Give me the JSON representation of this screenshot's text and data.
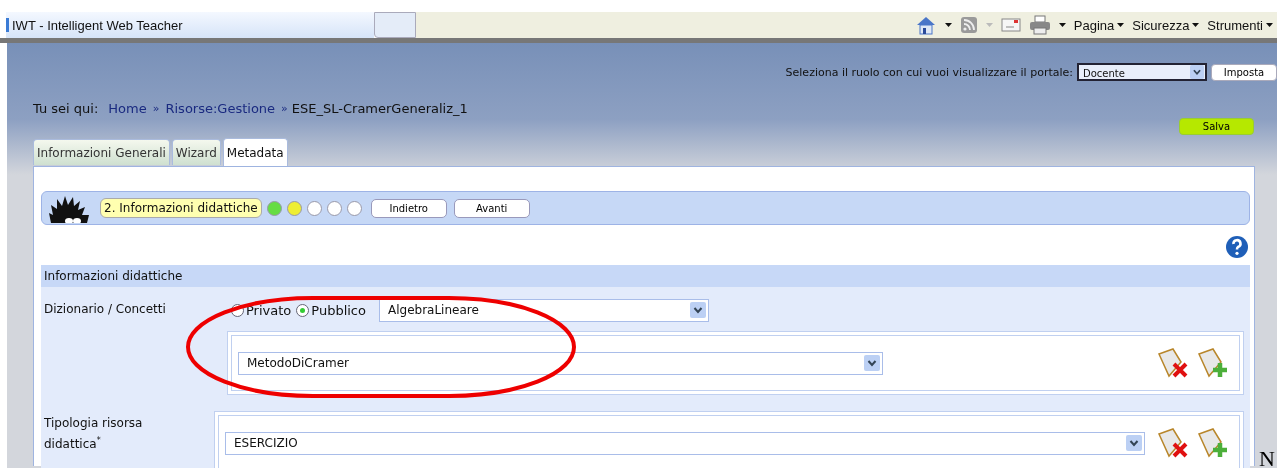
{
  "browser": {
    "tab_title": "IWT - Intelligent Web Teacher",
    "menus": [
      {
        "label": "Pagina"
      },
      {
        "label": "Sicurezza"
      },
      {
        "label": "Strumenti"
      }
    ]
  },
  "role_bar": {
    "label": "Seleziona il ruolo con cui vuoi visualizzare il portale:",
    "value": "Docente",
    "button": "Imposta"
  },
  "breadcrumb": {
    "label": "Tu sei qui:",
    "items": [
      {
        "text": "Home",
        "kind": "link"
      },
      {
        "separator": "»",
        "text": "Risorse:Gestione",
        "kind": "link"
      },
      {
        "separator": "»",
        "text": "ESE_SL-CramerGeneraliz_1",
        "kind": "current"
      }
    ]
  },
  "save_button": "Salva",
  "tabs": [
    {
      "label": "Informazioni Generali",
      "selected": false
    },
    {
      "label": "Wizard",
      "selected": false
    },
    {
      "label": "Metadata",
      "selected": true
    }
  ],
  "wizard": {
    "step_label": "2. Informazioni didattiche",
    "steps": [
      {
        "color": "#66dd44"
      },
      {
        "color": "#eeee33"
      },
      {
        "color": "#ffffff"
      },
      {
        "color": "#ffffff"
      },
      {
        "color": "#ffffff"
      }
    ],
    "buttons": [
      "Indietro",
      "Avanti"
    ]
  },
  "section": {
    "title": "Informazioni didattiche",
    "fields": [
      {
        "label": "Dizionario / Concetti",
        "kind": "concepts",
        "visibility": [
          {
            "label": "Privato",
            "selected": false
          },
          {
            "label": "Pubblico",
            "selected": true
          }
        ],
        "dictionary": "AlgebraLineare",
        "values": [
          "MetodoDiCramer"
        ]
      },
      {
        "label": "Tipologia risorsa didattica$^{*}$",
        "kind": "select",
        "values": [
          "ESERCIZIO"
        ]
      }
    ]
  },
  "trailing_text": "N"
}
